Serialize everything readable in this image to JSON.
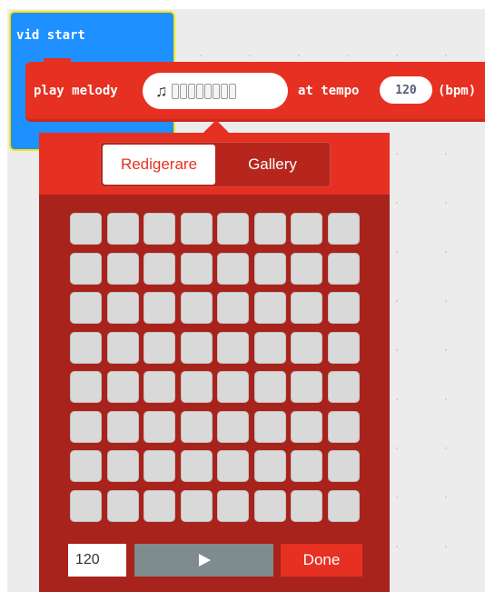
{
  "event_block": {
    "label": "vid start"
  },
  "melody_block": {
    "play_label": "play melody",
    "note_icon": "music-note-icon",
    "tempo_label": "at tempo",
    "tempo_value": "120",
    "bpm_label": "(bpm)"
  },
  "editor": {
    "tabs": [
      {
        "label": "Redigerare",
        "active": true
      },
      {
        "label": "Gallery",
        "active": false
      }
    ],
    "grid": {
      "rows": 8,
      "cols": 8,
      "active_cells": []
    },
    "tempo_input_value": "120",
    "play_icon": "play-icon",
    "done_label": "Done"
  },
  "colors": {
    "event_block": "#1e90ff",
    "event_border": "#f6e50a",
    "music_block": "#e63022",
    "popup_body": "#a8231b",
    "cell_off": "#d9d9d9",
    "play_button": "#7f8b8c"
  }
}
